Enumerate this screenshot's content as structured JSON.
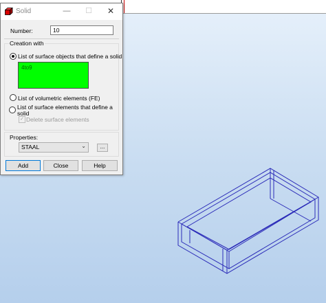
{
  "dialog": {
    "title": "Solid",
    "number_label": "Number:",
    "number_value": "10",
    "creation_group_label": "Creation with",
    "options": [
      "List of surface objects that define a solid",
      "List of volumetric elements (FE)",
      "List of surface elements that define a",
      "solid"
    ],
    "surface_list_value": "4to9",
    "delete_checkbox_label": "Delete surface elements",
    "properties_label": "Properties:",
    "properties_value": "STAAL",
    "more_label": "...",
    "buttons": {
      "add": "Add",
      "close": "Close",
      "help": "Help"
    }
  },
  "titlebar_controls": {
    "minimize": "—",
    "maximize": "☐",
    "close": "✕"
  },
  "colors": {
    "list_highlight": "#00ff00",
    "wireframe": "#2a2ab8",
    "viewport": "#c8dcf1"
  }
}
